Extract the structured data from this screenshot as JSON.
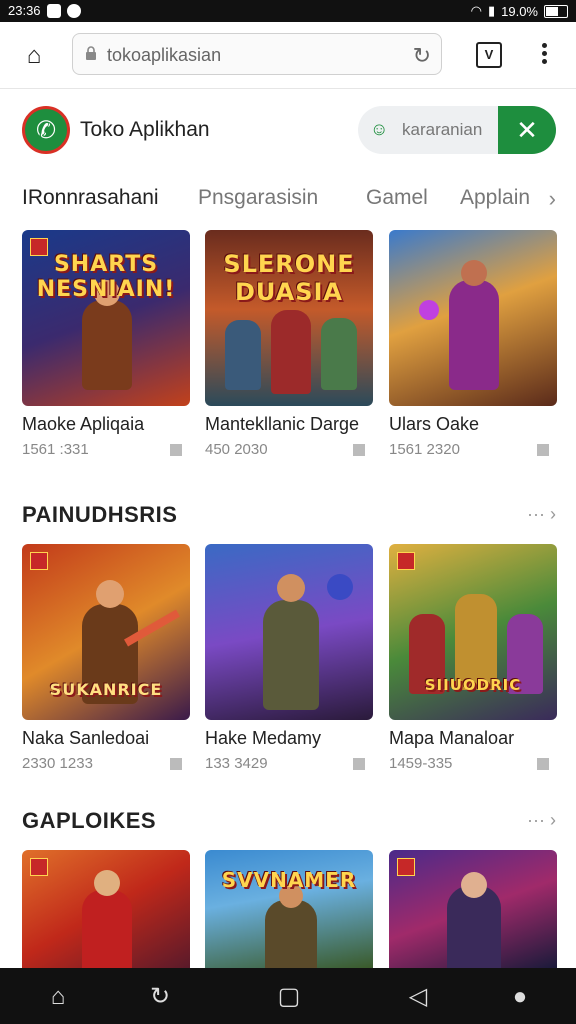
{
  "status": {
    "time": "23:36",
    "battery": "19.0%"
  },
  "browser": {
    "url": "tokoaplikasian"
  },
  "app": {
    "title": "Toko Aplikhan",
    "search_placeholder": "kararanian"
  },
  "category_tabs": [
    "IRonnrasahani",
    "Pnsgarasisin",
    "Gamel",
    "Applain"
  ],
  "sections": [
    {
      "title": "",
      "cards": [
        {
          "name": "Maoke Apliqaia",
          "meta": "1561 :331",
          "art_text": "SHARTS NESNIAIN!"
        },
        {
          "name": "Mantekllanic Darge",
          "meta": "450 2030",
          "art_text": "SLERONE DUASIA"
        },
        {
          "name": "Ulars Oake",
          "meta": "1561 2320",
          "art_text": ""
        }
      ]
    },
    {
      "title": "PAINUDHSRIS",
      "cards": [
        {
          "name": "Naka Sanledoai",
          "meta": "2330 1233",
          "art_text": "SUKANRICE"
        },
        {
          "name": "Hake Medamy",
          "meta": "133 3429",
          "art_text": ""
        },
        {
          "name": "Mapa Manaloar",
          "meta": "1459-335",
          "art_text": "SIIUODRIC"
        }
      ]
    },
    {
      "title": "GAPLOIKES",
      "cards": [
        {
          "name": "",
          "meta": "",
          "art_text": ""
        },
        {
          "name": "",
          "meta": "",
          "art_text": "SVVNAMER"
        },
        {
          "name": "",
          "meta": "",
          "art_text": ""
        }
      ]
    }
  ],
  "colors": {
    "accent": "#1e8e3e",
    "danger": "#d93025"
  }
}
